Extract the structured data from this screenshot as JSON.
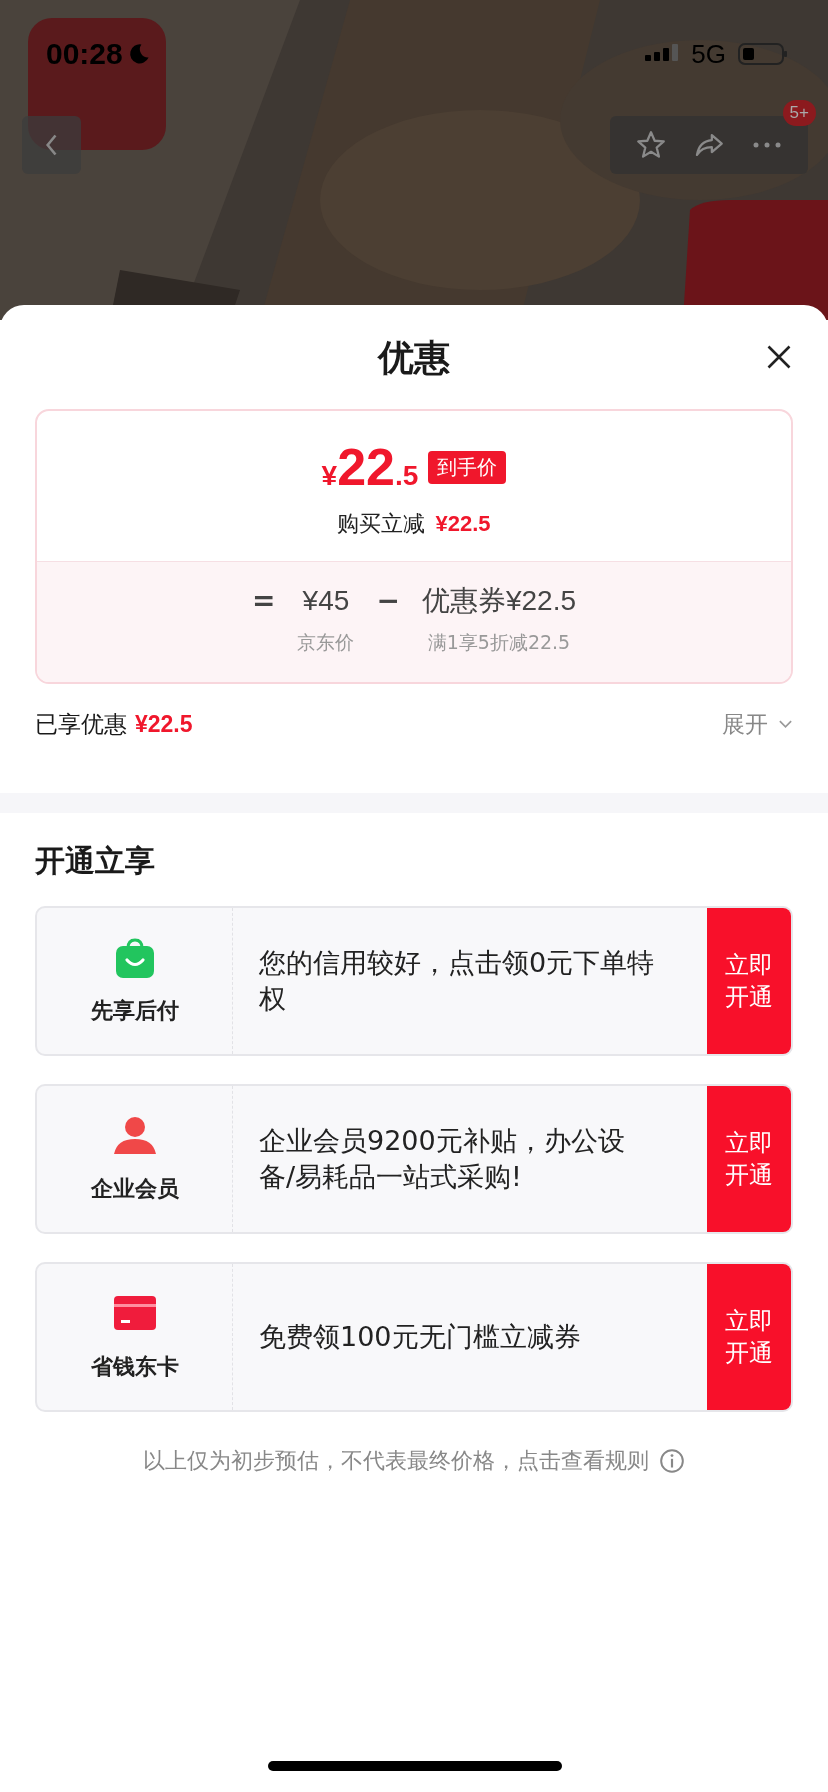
{
  "status_bar": {
    "time": "00:28",
    "network": "5G"
  },
  "header": {
    "badge": "5+"
  },
  "sheet": {
    "title": "优惠",
    "price": {
      "currency": "¥",
      "integer": "22",
      "decimal": ".5",
      "tag": "到手价",
      "note": "购买立减",
      "note_amount": "¥22.5"
    },
    "formula": {
      "equals": "=",
      "base": "¥45",
      "base_label": "京东价",
      "minus": "−",
      "coupon": "优惠券¥22.5",
      "coupon_label": "满1享5折减22.5"
    },
    "summary": {
      "label": "已享优惠",
      "amount": "¥22.5",
      "toggle": "展开"
    },
    "section_title": "开通立享",
    "offers": [
      {
        "kind": "bag",
        "name": "先享后付",
        "text": "您的信用较好，点击领0元下单特权",
        "button": "立即开通"
      },
      {
        "kind": "person",
        "name": "企业会员",
        "text": "企业会员9200元补贴，办公设备/易耗品一站式采购!",
        "button": "立即开通"
      },
      {
        "kind": "card",
        "name": "省钱东卡",
        "text": "免费领100元无门槛立减券",
        "button": "立即开通"
      }
    ],
    "footer": "以上仅为初步预估，不代表最终价格，点击查看规则"
  }
}
